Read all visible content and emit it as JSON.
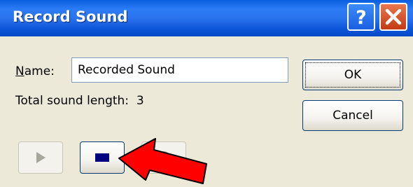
{
  "window": {
    "title": "Record Sound",
    "help_icon": "help-question-icon",
    "close_icon": "close-x-icon"
  },
  "form": {
    "name_label_accel": "N",
    "name_label_rest": "ame:",
    "name_value": "Recorded Sound",
    "length_label": "Total sound length:",
    "length_value": "3"
  },
  "buttons": {
    "ok": "OK",
    "cancel": "Cancel"
  },
  "controls": {
    "play_icon": "play-icon",
    "stop_icon": "stop-icon",
    "record_icon": "record-icon"
  },
  "annotation": {
    "arrow_color": "#ff0000",
    "arrow_target": "stop-button"
  },
  "colors": {
    "titlebar": "#0a5fe0",
    "dialog_bg": "#ece9d8",
    "stop_square": "#000080"
  }
}
